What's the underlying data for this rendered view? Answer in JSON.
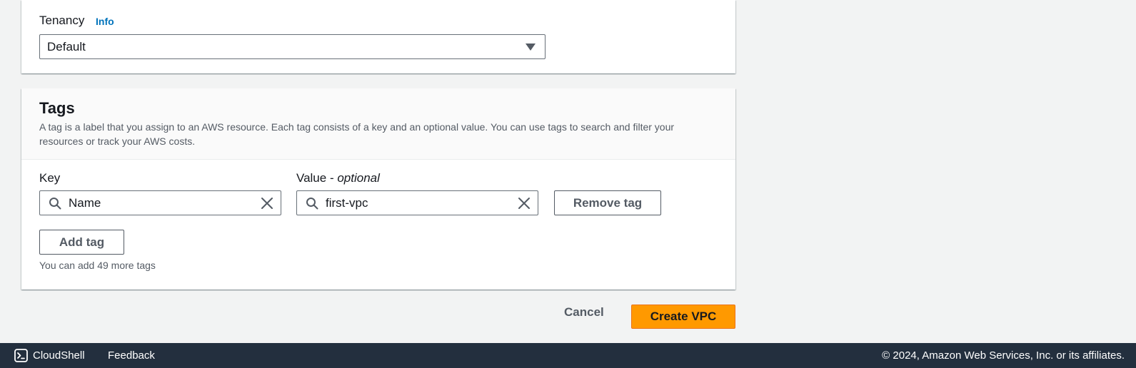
{
  "tenancy": {
    "label": "Tenancy",
    "info_link": "Info",
    "selected": "Default"
  },
  "tags": {
    "title": "Tags",
    "description": "A tag is a label that you assign to an AWS resource. Each tag consists of a key and an optional value. You can use tags to search and filter your resources or track your AWS costs.",
    "key_label": "Key",
    "value_label": "Value - ",
    "value_label_optional": "optional",
    "rows": [
      {
        "key": "Name",
        "value": "first-vpc",
        "remove_label": "Remove tag"
      }
    ],
    "add_label": "Add tag",
    "hint": "You can add 49 more tags"
  },
  "actions": {
    "cancel_label": "Cancel",
    "create_label": "Create VPC"
  },
  "footer": {
    "cloudshell_label": "CloudShell",
    "feedback_label": "Feedback",
    "copyright": "© 2024, Amazon Web Services, Inc. or its affiliates."
  },
  "icons": {
    "cloudshell": "cloudshell-icon",
    "search": "search-icon",
    "clear": "close-icon",
    "dropdown": "caret-down-icon"
  },
  "colors": {
    "primary_button": "#ff9900",
    "link": "#0073bb",
    "footer_bg": "#232f3e",
    "page_bg": "#f2f3f3"
  }
}
